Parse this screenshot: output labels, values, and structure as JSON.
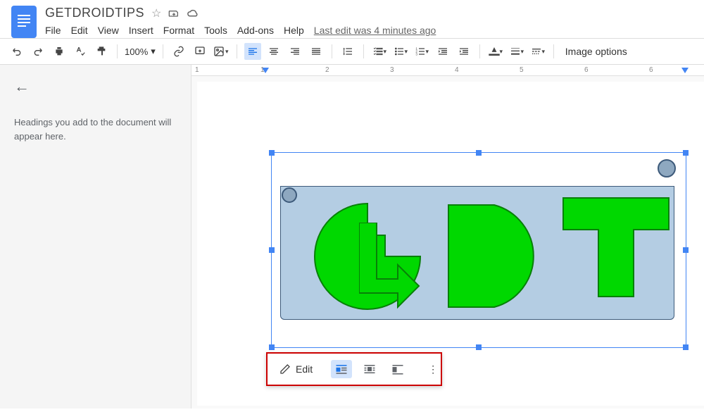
{
  "doc": {
    "title": "GETDROIDTIPS"
  },
  "menu": {
    "file": "File",
    "edit": "Edit",
    "view": "View",
    "insert": "Insert",
    "format": "Format",
    "tools": "Tools",
    "addons": "Add-ons",
    "help": "Help",
    "last_edit": "Last edit was 4 minutes ago"
  },
  "toolbar": {
    "zoom": "100%",
    "image_options": "Image options"
  },
  "outline": {
    "hint": "Headings you add to the document will appear here."
  },
  "ruler": {
    "marks": [
      "1",
      "2",
      "3",
      "4",
      "5",
      "6"
    ]
  },
  "image_toolbar": {
    "edit": "Edit"
  }
}
